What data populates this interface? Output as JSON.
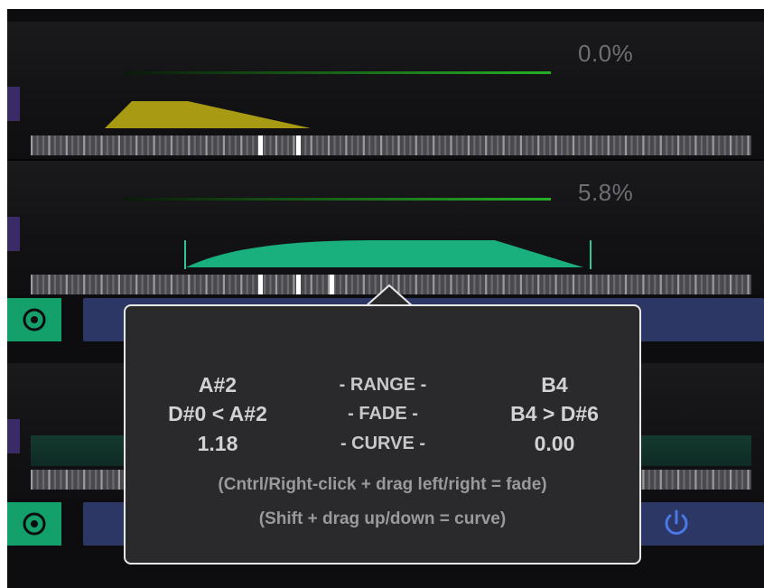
{
  "lanes": [
    {
      "level_percent": "0.0%"
    },
    {
      "level_percent": "5.8%"
    }
  ],
  "colors": {
    "lane1_curve": "#a89a12",
    "lane2_curve": "#1ab07e",
    "level_line": "#1f9a1f",
    "accent_green": "#14a06a",
    "blue_bar": "#2c3766"
  },
  "icons": {
    "target": "target-icon",
    "power": "power-icon"
  },
  "tooltip": {
    "left": {
      "range": "A#2",
      "fade": "D#0 < A#2",
      "curve": "1.18"
    },
    "middle": {
      "range": "- RANGE -",
      "fade": "- FADE -",
      "curve": "- CURVE -"
    },
    "right": {
      "range": "B4",
      "fade": "B4 > D#6",
      "curve": "0.00"
    },
    "hint_fade": "(Cntrl/Right-click + drag left/right = fade)",
    "hint_curve": "(Shift + drag up/down = curve)"
  }
}
